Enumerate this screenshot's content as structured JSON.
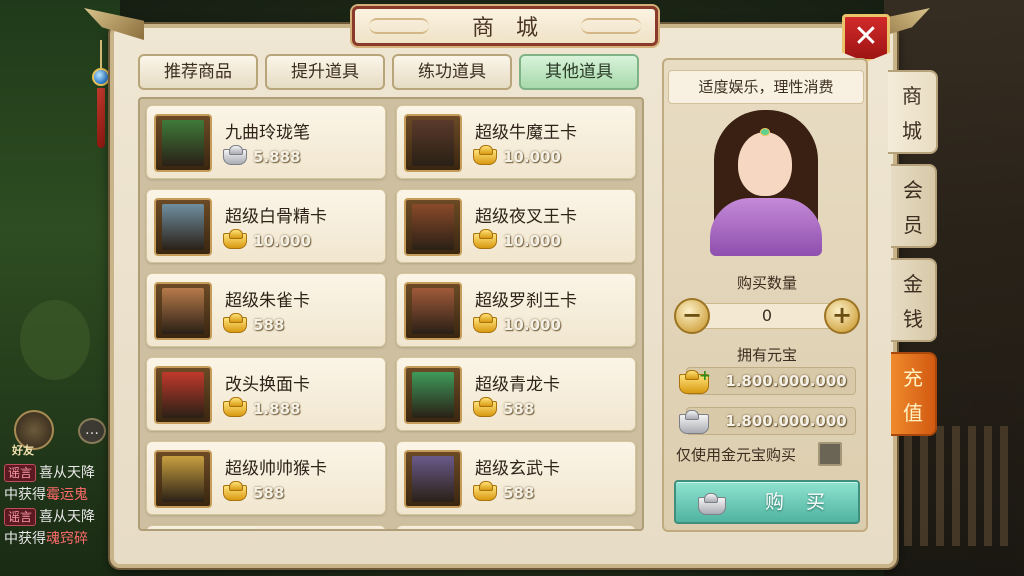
{
  "title": "商城",
  "tabs": [
    {
      "label": "推荐商品",
      "active": false
    },
    {
      "label": "提升道具",
      "active": false
    },
    {
      "label": "练功道具",
      "active": false
    },
    {
      "label": "其他道具",
      "active": true
    }
  ],
  "items": [
    {
      "name": "九曲玲珑笔",
      "currency": "silver",
      "price": "5.888",
      "icon": "jade-brush-icon"
    },
    {
      "name": "超级牛魔王卡",
      "currency": "gold",
      "price": "10.000",
      "icon": "bull-demon-card-icon"
    },
    {
      "name": "超级白骨精卡",
      "currency": "gold",
      "price": "10.000",
      "icon": "white-bone-demon-card-icon"
    },
    {
      "name": "超级夜叉王卡",
      "currency": "gold",
      "price": "10.000",
      "icon": "yaksha-king-card-icon"
    },
    {
      "name": "超级朱雀卡",
      "currency": "gold",
      "price": "588",
      "icon": "vermilion-bird-card-icon"
    },
    {
      "name": "超级罗刹王卡",
      "currency": "gold",
      "price": "10.000",
      "icon": "rakshasa-king-card-icon"
    },
    {
      "name": "改头换面卡",
      "currency": "gold",
      "price": "1.888",
      "icon": "opera-mask-card-icon"
    },
    {
      "name": "超级青龙卡",
      "currency": "gold",
      "price": "588",
      "icon": "azure-dragon-card-icon"
    },
    {
      "name": "超级帅帅猴卡",
      "currency": "gold",
      "price": "588",
      "icon": "handsome-monkey-card-icon"
    },
    {
      "name": "超级玄武卡",
      "currency": "gold",
      "price": "588",
      "icon": "black-tortoise-card-icon"
    }
  ],
  "side": {
    "slogan": "适度娱乐，理性消费",
    "qty_label": "购买数量",
    "qty_value": "0",
    "qty_minus": "−",
    "qty_plus": "+",
    "own_label": "拥有元宝",
    "gold_balance": "1.800.000.000",
    "silver_balance": "1.800.000.000",
    "gold_only_label": "仅使用金元宝购买",
    "buy_label": "购买"
  },
  "side_tabs": [
    {
      "label": [
        "商",
        "城"
      ],
      "active": true
    },
    {
      "label": [
        "会",
        "员"
      ],
      "active": false
    },
    {
      "label": [
        "金",
        "钱"
      ],
      "active": false
    },
    {
      "label": [
        "充",
        "值"
      ],
      "active": false
    }
  ],
  "close_label": "✕",
  "chat": {
    "friend_label": "好友",
    "bubble": "…",
    "lines": [
      {
        "tag": "谣言",
        "text": "喜从天降"
      },
      {
        "text": "中获得",
        "highlight": "霉运鬼"
      },
      {
        "tag": "谣言",
        "text": "喜从天降"
      },
      {
        "text": "中获得",
        "highlight": "魂窍碎"
      }
    ]
  },
  "colors": {
    "gold": "#e2a422",
    "silver": "#b8bbc2",
    "tab_active": "#a7d9ab",
    "recharge": "#e0731f",
    "close": "#c41f1f",
    "buy": "#5fc2ad"
  }
}
